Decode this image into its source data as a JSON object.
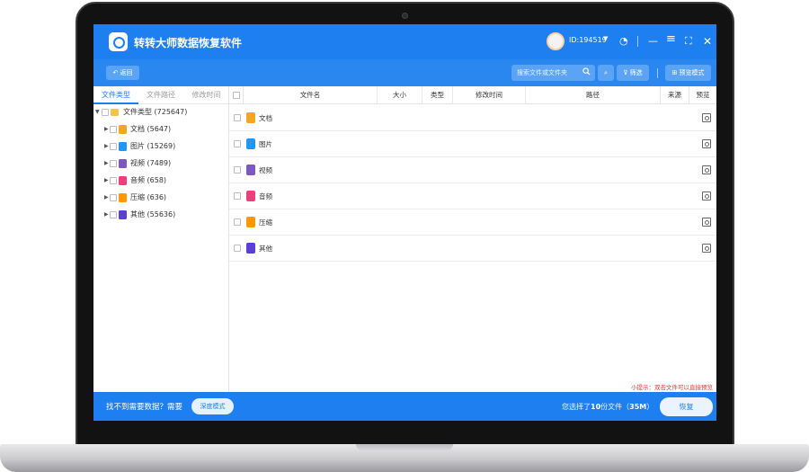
{
  "app": {
    "title": "转转大师数据恢复软件",
    "user_id": "ID:194519",
    "icons": [
      "user-avatar",
      "chevron-down-icon",
      "headset-icon",
      "minimize-icon",
      "menu-icon",
      "maximize-icon",
      "close-icon"
    ]
  },
  "toolbar": {
    "back_label": "返回",
    "search_placeholder": "搜索文件或文件夹",
    "filter_label": "筛选",
    "preview_mode_label": "预览模式"
  },
  "left_tabs": [
    {
      "label": "文件类型",
      "active": true
    },
    {
      "label": "文件路径",
      "active": false
    },
    {
      "label": "修改时间",
      "active": false
    }
  ],
  "tree": {
    "root": {
      "label": "文件类型 (725647)",
      "expanded": true
    },
    "items": [
      {
        "label": "文档 (5647)",
        "icon": "document-icon",
        "color": "#f5a623"
      },
      {
        "label": "图片 (15269)",
        "icon": "image-icon",
        "color": "#2196f3"
      },
      {
        "label": "视频 (7489)",
        "icon": "video-icon",
        "color": "#7e57c2"
      },
      {
        "label": "音频 (658)",
        "icon": "audio-icon",
        "color": "#ec407a"
      },
      {
        "label": "压缩 (636)",
        "icon": "archive-icon",
        "color": "#ff9800"
      },
      {
        "label": "其他 (55636)",
        "icon": "other-icon",
        "color": "#5c3fd6"
      }
    ]
  },
  "table": {
    "columns": [
      "文件名",
      "大小",
      "类型",
      "修改时间",
      "路径",
      "来源",
      "预览"
    ],
    "rows": [
      {
        "name": "文档",
        "icon": "document-icon",
        "color": "#f5a623"
      },
      {
        "name": "图片",
        "icon": "image-icon",
        "color": "#2196f3"
      },
      {
        "name": "视频",
        "icon": "video-icon",
        "color": "#7e57c2"
      },
      {
        "name": "音频",
        "icon": "audio-icon",
        "color": "#ec407a"
      },
      {
        "name": "压缩",
        "icon": "archive-icon",
        "color": "#ff9800"
      },
      {
        "name": "其他",
        "icon": "other-icon",
        "color": "#5c3fd6"
      }
    ]
  },
  "hint": "小提示：双击文件可以直接预览",
  "bottom": {
    "message": "找不到需要数据？需要",
    "deep_mode_label": "深度模式",
    "selection_prefix": "您选择了",
    "selection_count": "10",
    "selection_unit": "份文件（",
    "selection_size": "35M",
    "selection_suffix": "）",
    "recover_label": "恢复"
  },
  "colors": {
    "primary": "#1e7ff0",
    "hint": "#e53935"
  }
}
